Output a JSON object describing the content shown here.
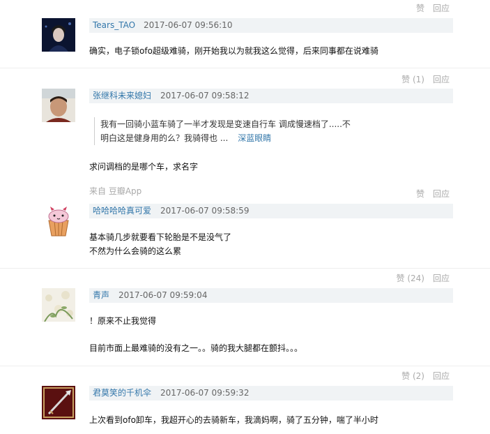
{
  "comments": [
    {
      "user": "Tears_TAO",
      "time": "2017-06-07 09:56:10",
      "like_label": "赞",
      "reply_label": "回应",
      "text_lines": [
        "确实，电子锁ofo超级难骑，刚开始我以为就我这么觉得，后来同事都在说难骑"
      ]
    },
    {
      "user": "张继科未来媳妇",
      "time": "2017-06-07 09:58:12",
      "like_label": "赞 (1)",
      "reply_label": "回应",
      "quote_lines": [
        "我有一回骑小蓝车骑了一半才发现是变速自行车 调成慢速档了.....不",
        "明白这是健身用的么？我骑得也 ..."
      ],
      "quote_author": "深蓝眼睛",
      "text_lines": [
        "求问调档的是哪个车，求名字"
      ],
      "source": "来自 豆瓣App"
    },
    {
      "user": "哈哈哈哈真可爱",
      "time": "2017-06-07 09:58:59",
      "like_label": "赞",
      "reply_label": "回应",
      "text_lines": [
        "基本骑几步就要看下轮胎是不是没气了",
        "不然为什么会骑的这么累"
      ]
    },
    {
      "user": "青声",
      "time": "2017-06-07 09:59:04",
      "like_label": "赞 (24)",
      "reply_label": "回应",
      "text_lines": [
        "！原来不止我觉得",
        "目前市面上最难骑的没有之一。。骑的我大腿都在颤抖。。。"
      ]
    },
    {
      "user": "君莫笑的千机伞",
      "time": "2017-06-07 09:59:32",
      "like_label": "赞 (2)",
      "reply_label": "回应",
      "text_lines": [
        "上次看到ofo卸车，我超开心的去骑新车，我滴妈啊，骑了五分钟，喘了半小时"
      ]
    }
  ]
}
